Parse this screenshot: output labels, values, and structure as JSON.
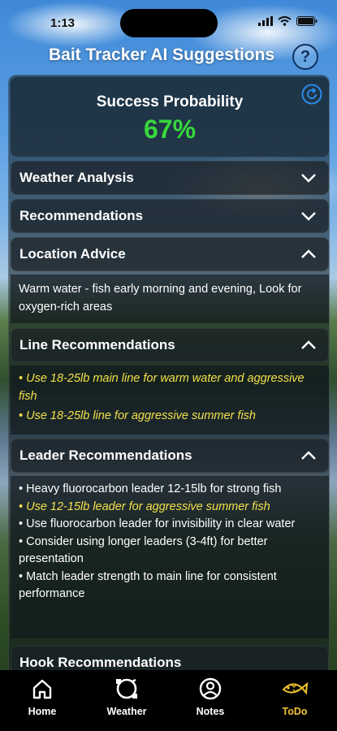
{
  "status": {
    "time": "1:13"
  },
  "header": {
    "title": "Bait Tracker AI Suggestions",
    "help_label": "?"
  },
  "probability": {
    "label": "Success Probability",
    "value": "67%"
  },
  "sections": {
    "weather": {
      "label": "Weather Analysis"
    },
    "recommendations": {
      "label": "Recommendations"
    },
    "location": {
      "label": "Location Advice",
      "text": "Warm water - fish early morning and evening, Look for oxygen-rich areas"
    },
    "line": {
      "label": "Line Recommendations",
      "items": [
        "• Use 18-25lb main line for warm water and aggressive fish",
        "• Use 18-25lb line for aggressive summer fish"
      ]
    },
    "leader": {
      "label": "Leader Recommendations",
      "items": [
        "• Heavy fluorocarbon leader 12-15lb for strong fish",
        "• Use 12-15lb leader for aggressive summer fish",
        "• Use fluorocarbon leader for invisibility in clear water",
        "• Consider using longer leaders (3-4ft) for better presentation",
        "• Match leader strength to main line for consistent performance"
      ]
    },
    "hook": {
      "label": "Hook Recommendations"
    }
  },
  "tabs": [
    {
      "label": "Home",
      "icon": "home-icon"
    },
    {
      "label": "Weather",
      "icon": "weather-icon"
    },
    {
      "label": "Notes",
      "icon": "person-icon"
    },
    {
      "label": "ToDo",
      "icon": "fish-icon"
    }
  ],
  "colors": {
    "accent_green": "#38d83c",
    "highlight_yellow": "#f3e04a",
    "active_tab": "#f0c330"
  }
}
